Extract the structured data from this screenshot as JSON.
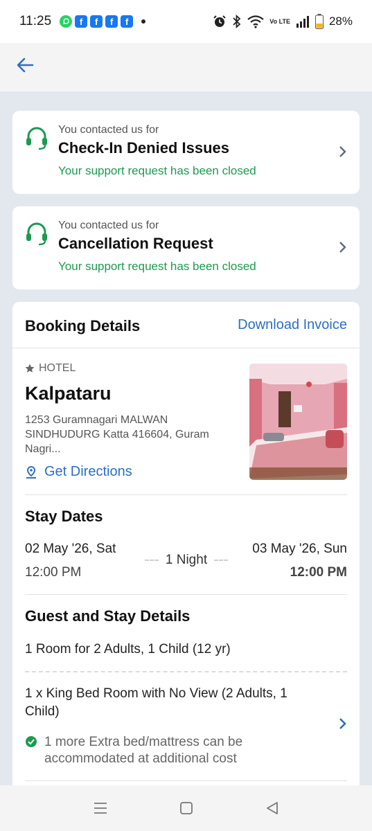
{
  "status_bar": {
    "time": "11:25",
    "battery": "28%",
    "network_label": "Vo LTE",
    "notification_apps": [
      "whatsapp-icon",
      "facebook-icon",
      "facebook-icon",
      "facebook-icon",
      "facebook-icon"
    ]
  },
  "header": {
    "back_icon": "arrow-left-icon"
  },
  "support_requests": [
    {
      "subtitle": "You contacted us for",
      "title": "Check-In Denied Issues",
      "status": "Your support request has been closed"
    },
    {
      "subtitle": "You contacted us for",
      "title": "Cancellation Request",
      "status": "Your support request has been closed"
    }
  ],
  "booking": {
    "title": "Booking Details",
    "download_label": "Download Invoice",
    "property_type": "HOTEL",
    "hotel_name": "Kalpataru",
    "address": "1253 Guramnagari MALWAN SINDHUDURG Katta 416604, Guram Nagri...",
    "directions_label": "Get Directions",
    "stay_dates_title": "Stay Dates",
    "checkin_date": "02 May '26, Sat",
    "checkin_time": "12:00 PM",
    "nights": "1 Night",
    "checkout_date": "03 May '26, Sun",
    "checkout_time": "12:00 PM",
    "guest_title": "Guest and Stay Details",
    "room_summary": "1 Room for 2 Adults, 1 Child (12 yr)",
    "room_type": "1 x King Bed Room with No View (2 Adults, 1 Child)",
    "extra_bed_note": "1 more Extra bed/mattress can be accommodated at additional cost"
  },
  "colors": {
    "accent_blue": "#2b6fc4",
    "success_green": "#1b9a52",
    "page_bg": "#e3e8ef"
  }
}
